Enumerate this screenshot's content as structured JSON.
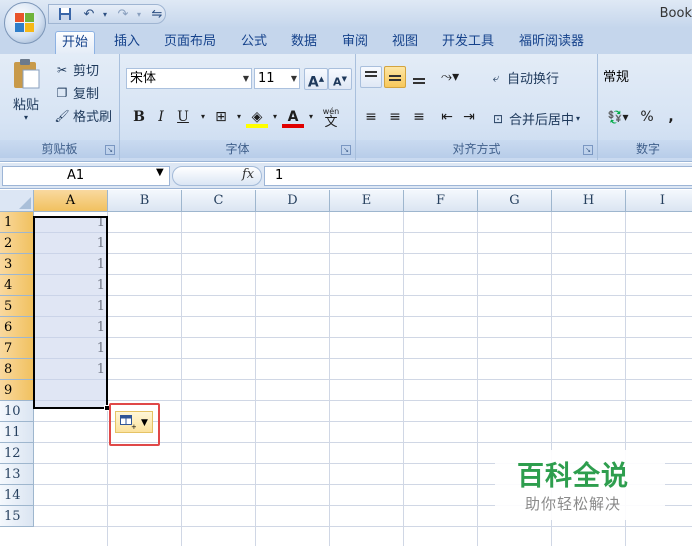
{
  "window": {
    "title": "Book"
  },
  "qat": {
    "undo_icon": "undo-icon",
    "redo_icon": "redo-icon",
    "more": "⇋"
  },
  "tabs": [
    "开始",
    "插入",
    "页面布局",
    "公式",
    "数据",
    "审阅",
    "视图",
    "开发工具",
    "福昕阅读器"
  ],
  "clipboard": {
    "paste": "粘贴",
    "cut": "剪切",
    "copy": "复制",
    "format_painter": "格式刷",
    "label": "剪贴板"
  },
  "font": {
    "name": "宋体",
    "size": "11",
    "grow": "A",
    "shrink": "A",
    "bold": "B",
    "italic": "I",
    "underline": "U",
    "color_letter": "A",
    "phonetic": "wén",
    "label": "字体"
  },
  "alignment": {
    "wrap_text": "自动换行",
    "merge_center": "合并后居中",
    "label": "对齐方式"
  },
  "number": {
    "format": "常规",
    "percent": "%",
    "comma": ",",
    "label": "数字"
  },
  "formula_bar": {
    "name_box": "A1",
    "fx": "fx",
    "value": "1"
  },
  "columns": [
    "A",
    "B",
    "C",
    "D",
    "E",
    "F",
    "G",
    "H",
    "I"
  ],
  "rows": [
    "1",
    "2",
    "3",
    "4",
    "5",
    "6",
    "7",
    "8",
    "9",
    "10",
    "11",
    "12",
    "13",
    "14",
    "15"
  ],
  "cells": [
    "1",
    "1",
    "1",
    "1",
    "1",
    "1",
    "1",
    "1"
  ],
  "watermark": {
    "title": "百科全说",
    "subtitle": "助你轻松解决"
  },
  "colors": {
    "accent_green": "#2e9e4e",
    "selected_header": "#f1c15f",
    "highlight_red": "#e04848"
  }
}
